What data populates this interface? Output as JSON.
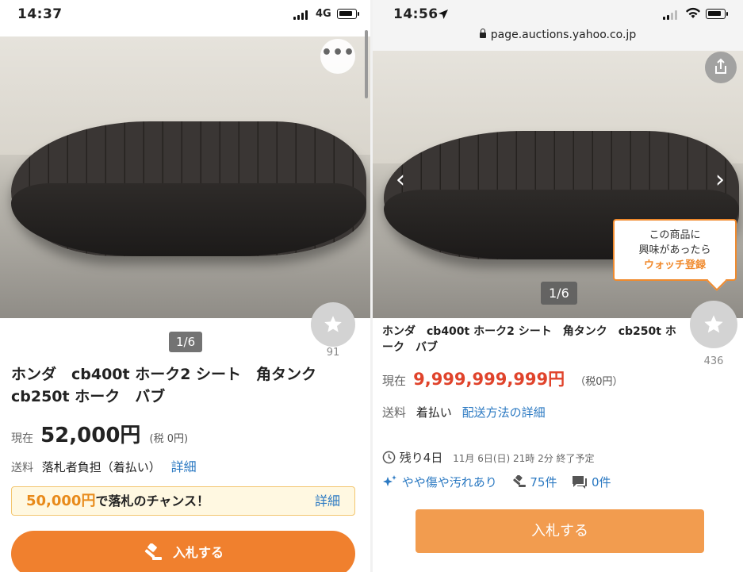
{
  "left": {
    "status": {
      "time": "14:37",
      "carrier": "4G"
    },
    "image_counter": "1/6",
    "more_button": "•••",
    "watch_count": "91",
    "title": "ホンダ　cb400t ホーク2 シート　角タンク cb250t ホーク　バブ",
    "price": {
      "label": "現在",
      "value": "52,000円",
      "tax": "(税 0円)"
    },
    "shipping": {
      "label": "送料",
      "value": "落札者負担（着払い）",
      "link": "詳細"
    },
    "chance": {
      "amount": "50,000円",
      "text": "で落札のチャンス！",
      "link": "詳細"
    },
    "bid_button": "入札する"
  },
  "right": {
    "status": {
      "time": "14:56"
    },
    "url": "page.auctions.yahoo.co.jp",
    "image_counter": "1/6",
    "tooltip": {
      "line1": "この商品に",
      "line2": "興味があったら",
      "action": "ウォッチ登録"
    },
    "watch_count": "436",
    "title": "ホンダ　cb400t ホーク2 シート　角タンク　cb250t ホーク　バブ",
    "price": {
      "label": "現在",
      "value": "9,999,999,999円",
      "tax": "（税0円）"
    },
    "shipping": {
      "label": "送料",
      "value": "着払い",
      "link": "配送方法の詳細"
    },
    "remaining": {
      "label": "残り4日",
      "end": "11月 6日(日) 21時 2分 終了予定"
    },
    "condition": "やや傷や汚れあり",
    "bids": "75件",
    "comments": "0件",
    "bid_button": "入札する"
  },
  "colors": {
    "accent": "#f0802e",
    "link": "#2b79c2",
    "price_red": "#e0432b"
  },
  "icons": [
    "more-icon",
    "star-icon",
    "share-icon",
    "chevron-left-icon",
    "chevron-right-icon",
    "clock-icon",
    "sparkle-icon",
    "gavel-icon",
    "comment-icon",
    "lock-icon",
    "location-arrow-icon",
    "wifi-icon",
    "battery-icon",
    "signal-icon"
  ]
}
